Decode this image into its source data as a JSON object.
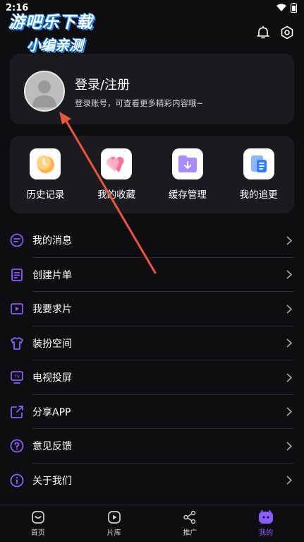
{
  "status": {
    "time": "2:16"
  },
  "watermark": {
    "line1": "游吧乐下载",
    "line2": "小编亲测"
  },
  "profile": {
    "title": "登录/注册",
    "subtitle": "登录账号，可查看更多精彩内容哦~"
  },
  "shortcuts": [
    {
      "label": "历史记录",
      "icon": "history-icon"
    },
    {
      "label": "我的收藏",
      "icon": "favorites-icon"
    },
    {
      "label": "缓存管理",
      "icon": "cache-folder-icon"
    },
    {
      "label": "我的追更",
      "icon": "follow-updates-icon"
    }
  ],
  "menu": [
    {
      "label": "我的消息",
      "icon": "message-icon"
    },
    {
      "label": "创建片单",
      "icon": "create-list-icon"
    },
    {
      "label": "我要求片",
      "icon": "request-video-icon"
    },
    {
      "label": "装扮空间",
      "icon": "shirt-icon"
    },
    {
      "label": "电视投屏",
      "icon": "tv-cast-icon"
    },
    {
      "label": "分享APP",
      "icon": "share-icon"
    },
    {
      "label": "意见反馈",
      "icon": "feedback-icon"
    },
    {
      "label": "关于我们",
      "icon": "info-icon"
    }
  ],
  "tabs": [
    {
      "label": "首页",
      "icon": "home-icon"
    },
    {
      "label": "片库",
      "icon": "library-icon"
    },
    {
      "label": "推广",
      "icon": "promote-share-icon"
    },
    {
      "label": "我的",
      "icon": "mine-icon",
      "active": true
    }
  ],
  "colors": {
    "accent": "#8a5cff",
    "background": "#0e0e11",
    "card": "#1a1a1f",
    "annotation_arrow": "#e8563f"
  }
}
